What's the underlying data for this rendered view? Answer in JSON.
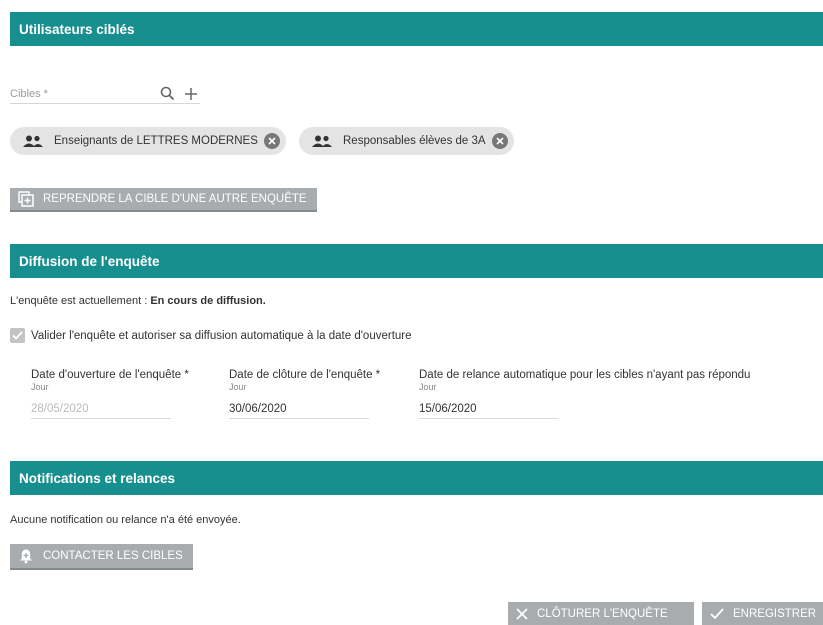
{
  "sections": {
    "targets": {
      "title": "Utilisateurs ciblés"
    },
    "diffusion": {
      "title": "Diffusion de l'enquête"
    },
    "notifications": {
      "title": "Notifications et relances"
    }
  },
  "targets": {
    "field_placeholder": "Cibles *",
    "search_icon": "search-icon",
    "add_icon": "plus-icon",
    "chips": [
      {
        "label": "Enseignants de LETTRES MODERNES",
        "icon": "people-icon"
      },
      {
        "label": "Responsables élèves de 3A",
        "icon": "people-icon"
      }
    ],
    "reuse_button": "REPRENDRE LA CIBLE D'UNE AUTRE ENQUÊTE"
  },
  "diffusion": {
    "status_prefix": "L'enquête est actuellement : ",
    "status_value": "En cours de diffusion.",
    "validate_label": "Valider l'enquête et autoriser sa diffusion automatique à la date d'ouverture",
    "validate_checked": true,
    "dates": [
      {
        "label": "Date d'ouverture de l'enquête *",
        "sub": "Jour",
        "value": "28/05/2020",
        "disabled": true
      },
      {
        "label": "Date de clôture de l'enquête *",
        "sub": "Jour",
        "value": "30/06/2020",
        "disabled": false
      },
      {
        "label": "Date de relance automatique pour les cibles n'ayant pas répondu",
        "sub": "Jour",
        "value": "15/06/2020",
        "disabled": false
      }
    ]
  },
  "notifications": {
    "message": "Aucune notification ou relance n'a été envoyée.",
    "contact_button": "CONTACTER LES CIBLES"
  },
  "footer": {
    "close_button": "CLÔTURER L'ENQUÊTE",
    "save_button": "ENREGISTRER"
  },
  "colors": {
    "header": "#178f8f",
    "button": "#a8acae",
    "chip": "#e4e4e4"
  }
}
